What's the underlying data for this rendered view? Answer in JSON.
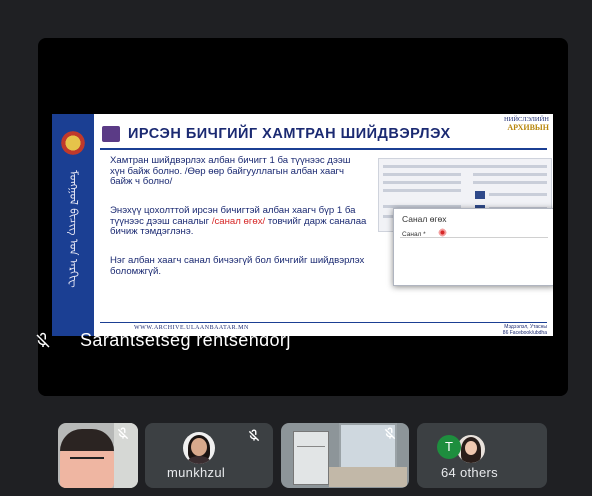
{
  "presentation": {
    "slide": {
      "logo_lines": [
        "НИЙСЛЭЛИЙН",
        "АРХИВЫН"
      ],
      "title": "ИРСЭН БИЧГИЙГ ХАМТРАН ШИЙДВЭРЛЭХ",
      "side_script": "ᠮᠣᠩᠭᠣᠯ ᠪᠢᠴᠢᠭ ᠤᠨ ᠠᠷᠬᠢᠸ",
      "paragraph_1": "Хамтран шийдвэрлэх албан бичигт 1 ба түүнээс дээш хүн байж болно. /Өөр өөр байгууллагын албан хаагч байж ч болно/",
      "paragraph_2_before": "Энэхүү цохолттой ирсэн бичигтэй албан хаагч бүр 1 ба түүнээс дээш саналыг",
      "paragraph_2_highlight": "/санал өгөх/",
      "paragraph_2_after": "товчийг дарж саналаа бичиж тэмдэглэнэ.",
      "paragraph_3": "Нэг албан хаагч санал бичээгүй бол бичгийг шийдвэрлэх боломжгүй.",
      "dialog_title": "Санал өгөх",
      "dialog_label": "Санал *",
      "footer_left": "WWW.ARCHIVE.ULAANBAATAR.MN",
      "footer_right_lines": [
        "Мэдээлэл, Утасны",
        "86 Facebook/ubdha"
      ]
    },
    "speaker_name": "Sarantsetseg rentsendorj"
  },
  "participants": [
    {
      "name": "",
      "muted": true
    },
    {
      "name": "munkhzul",
      "muted": true
    },
    {
      "name": "",
      "muted": true
    },
    {
      "name": "64 others",
      "initial": "T"
    }
  ],
  "colors": {
    "background": "#1f2023",
    "slide_title": "#1b2a72",
    "highlight": "#d62828",
    "tile": "#3c4043",
    "avatar_t": "#1e8e3e"
  },
  "icons": [
    "mic-off-icon",
    "avatar-icon"
  ]
}
